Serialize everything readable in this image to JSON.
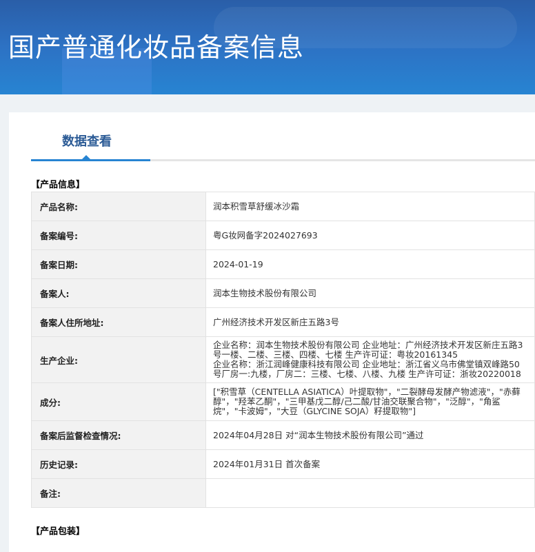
{
  "header": {
    "title": "国产普通化妆品备案信息"
  },
  "tabs": [
    {
      "label": "数据查看"
    }
  ],
  "sections": {
    "product_info": "【产品信息】",
    "product_packaging": "【产品包装】"
  },
  "rows": [
    {
      "label": "产品名称:",
      "value": "润本积雪草舒缓冰沙霜"
    },
    {
      "label": "备案编号:",
      "value": "粤G妆网备字2024027693"
    },
    {
      "label": "备案日期:",
      "value": "2024-01-19"
    },
    {
      "label": "备案人:",
      "value": "润本生物技术股份有限公司"
    },
    {
      "label": "备案人住所地址:",
      "value": "广州经济技术开发区新庄五路3号"
    },
    {
      "label": "生产企业:",
      "value": "企业名称：润本生物技术股份有限公司 企业地址：广州经济技术开发区新庄五路3号一楼、二楼、三楼、四楼、七楼 生产许可证：粤妆20161345",
      "value2": "企业名称：浙江润峰健康科技有限公司 企业地址：浙江省义乌市佛堂镇双峰路50号厂房一:九楼，厂房二：三楼、七楼、八楼、九楼 生产许可证：浙妆20220018"
    },
    {
      "label": "成分:",
      "value": "[\"积雪草（CENTELLA ASIATICA）叶提取物\"，\"二裂酵母发酵产物滤液\"，\"赤藓醇\"，\"羟苯乙酮\"，\"三甲基戊二醇/己二酸/甘油交联聚合物\"，\"泛醇\"，\"角鲨烷\"，\"卡波姆\"，\"大豆（GLYCINE SOJA）籽提取物\"]"
    },
    {
      "label": "备案后监督检查情况:",
      "value": "2024年04月28日 对“润本生物技术股份有限公司”通过"
    },
    {
      "label": "历史记录:",
      "value": "2024年01月31日 首次备案"
    },
    {
      "label": "备注:",
      "value": ""
    }
  ]
}
